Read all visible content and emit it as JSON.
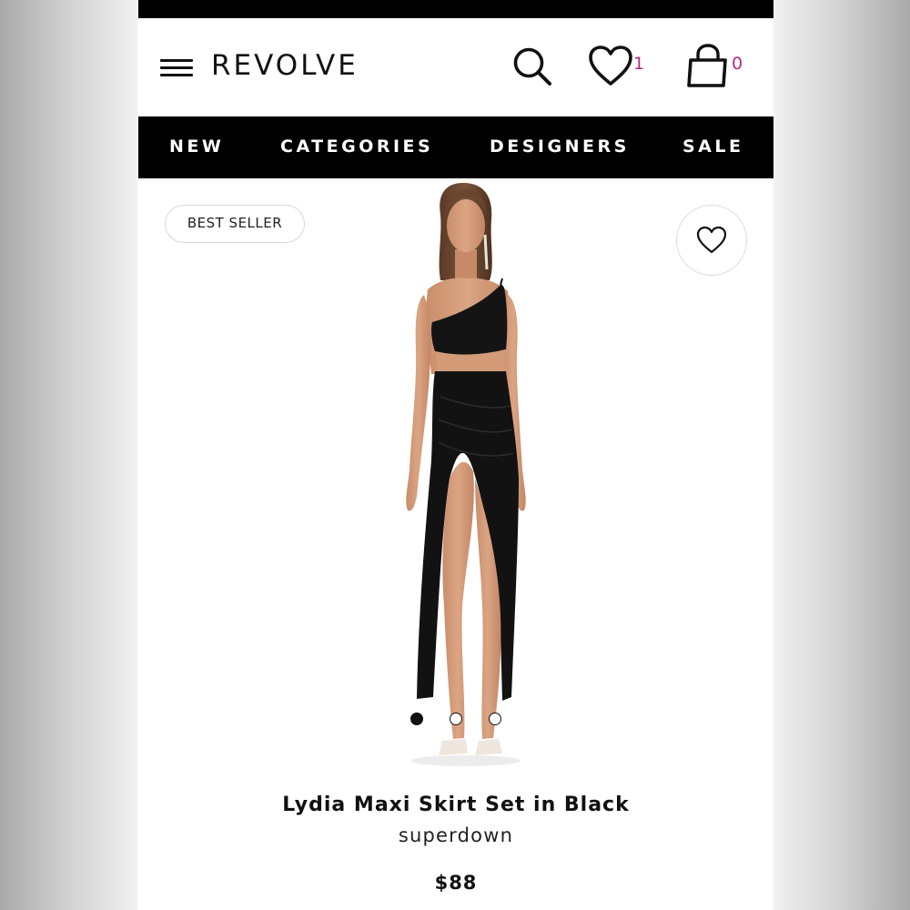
{
  "header": {
    "brand": "REVOLVE",
    "wishlist_count": "1",
    "bag_count": "0",
    "badge_color": "#b22a88",
    "icons": [
      "menu-icon",
      "search-icon",
      "heart-icon",
      "shopping-bag-icon"
    ]
  },
  "nav": {
    "items": [
      {
        "label": "NEW"
      },
      {
        "label": "CATEGORIES"
      },
      {
        "label": "DESIGNERS"
      },
      {
        "label": "SALE"
      }
    ]
  },
  "product": {
    "badge": "BEST SELLER",
    "title": "Lydia Maxi Skirt Set in Black",
    "brand": "superdown",
    "price": "$88",
    "image_count": 3,
    "active_image": 1
  },
  "colors": {
    "nav_background": "#000000",
    "page_background": "#ffffff",
    "accent": "#b22a88"
  }
}
